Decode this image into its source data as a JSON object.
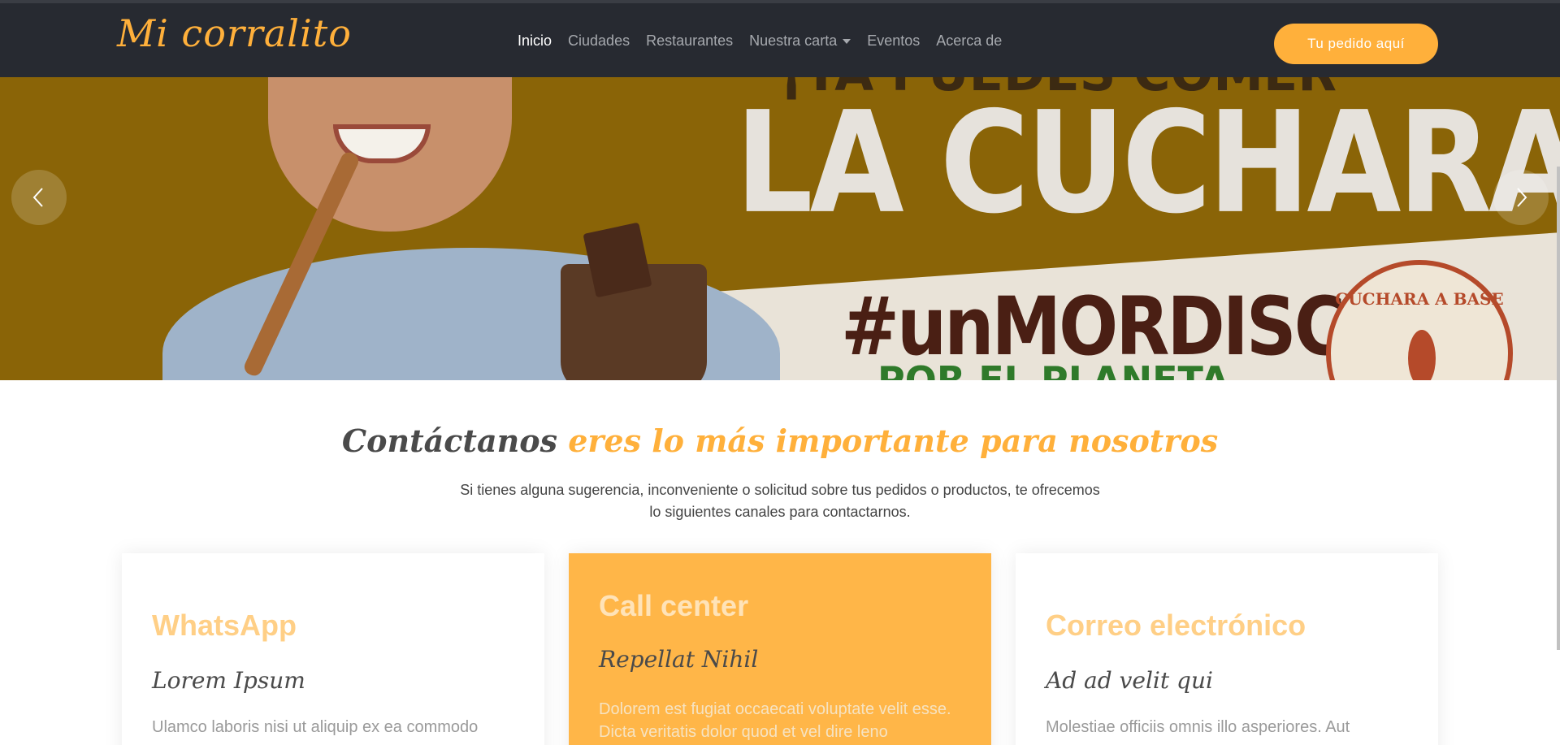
{
  "header": {
    "logo": "Mi corralito",
    "nav": [
      {
        "label": "Inicio",
        "active": true
      },
      {
        "label": "Ciudades",
        "active": false
      },
      {
        "label": "Restaurantes",
        "active": false
      },
      {
        "label": "Nuestra carta",
        "active": false,
        "dropdown": true
      },
      {
        "label": "Eventos",
        "active": false
      },
      {
        "label": "Acerca de",
        "active": false
      }
    ],
    "cta": "Tu pedido aquí"
  },
  "hero": {
    "top_text": "¡YA PUEDES COMER",
    "headline": "LA CUCHARA!",
    "hashtag": "#unMORDISCO",
    "bottom_text": "POR EL PLANETA",
    "badge_text": "CUCHARA A BASE",
    "slides_count": 4,
    "active_slide": 1,
    "prev_icon": "chevron-left-icon",
    "next_icon": "chevron-right-icon"
  },
  "contact": {
    "title_dark": "Contáctanos",
    "title_accent": "eres lo más importante para nosotros",
    "description": "Si tienes alguna sugerencia, inconveniente o solicitud sobre tus pedidos o productos, te ofrecemos lo siguientes canales para contactarnos.",
    "cards": [
      {
        "title": "WhatsApp",
        "subtitle": "Lorem Ipsum",
        "text": "Ulamco laboris nisi ut aliquip ex ea commodo"
      },
      {
        "title": "Call center",
        "subtitle": "Repellat Nihil",
        "text": "Dolorem est fugiat occaecati voluptate velit esse. Dicta veritatis dolor quod et vel dire leno"
      },
      {
        "title": "Correo electrónico",
        "subtitle": "Ad ad velit qui",
        "text": "Molestiae officiis omnis illo asperiores. Aut"
      }
    ]
  },
  "colors": {
    "accent": "#ffb03b",
    "header_bg": "#272a31",
    "featured_card": "#ffb648"
  }
}
